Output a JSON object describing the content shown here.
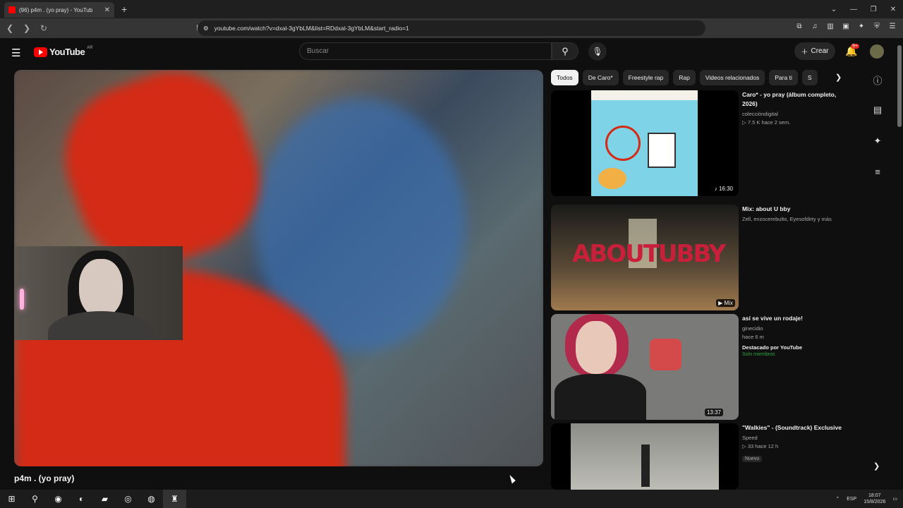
{
  "browser": {
    "tab_title": "(96) p4m . (yo pray) - YouTub",
    "tab_close": "✕",
    "new_tab": "+",
    "url": "youtube.com/watch?v=dxal-3gYbLM&list=RDdxal-3gYbLM&start_radio=1",
    "window_controls": [
      "⌄",
      "—",
      "❐",
      "✕"
    ]
  },
  "header": {
    "logo_text": "YouTube",
    "region": "AR",
    "search_placeholder": "Buscar",
    "create_label": "Crear",
    "notifications_count": "9+"
  },
  "player": {
    "title": "p4m . (yo pray)"
  },
  "chips": [
    "Todos",
    "De Caro*",
    "Freestyle rap",
    "Rap",
    "Videos relacionados",
    "Para ti",
    "S"
  ],
  "recommendations": [
    {
      "title": "Caro* - yo pray (álbum completo, 2026)",
      "channel": "coleccióndigital",
      "stats": "▷ 7.5 K  hace 2 sem.",
      "duration": "♪ 16:30"
    },
    {
      "title": "Mix: about      U      bby",
      "channel": "Zell, enzocerebulto, Eyesofdirty y más",
      "duration": "▶ Mix"
    },
    {
      "title": "así se vive un rodaje!",
      "channel": "ginecidio",
      "stats": "hace 6 m",
      "featured": "Destacado por YouTube",
      "members": "Solo miembros",
      "duration": "13:37"
    },
    {
      "title": "\"Walkies\" - (Soundtrack) Exclusive",
      "channel": "Speed",
      "stats": "▷ 33  hace 12 h",
      "badge": "Nuevo"
    }
  ],
  "thumb_texts": {
    "rec2_text": "ABOUTUBBY"
  },
  "taskbar": {
    "lang": "ESP",
    "time": "18:07",
    "date": "15/8/2026"
  },
  "colors": {
    "youtube_red": "#ff0000",
    "background": "#0f0f0f",
    "chip_active": "#f1f1f1"
  }
}
